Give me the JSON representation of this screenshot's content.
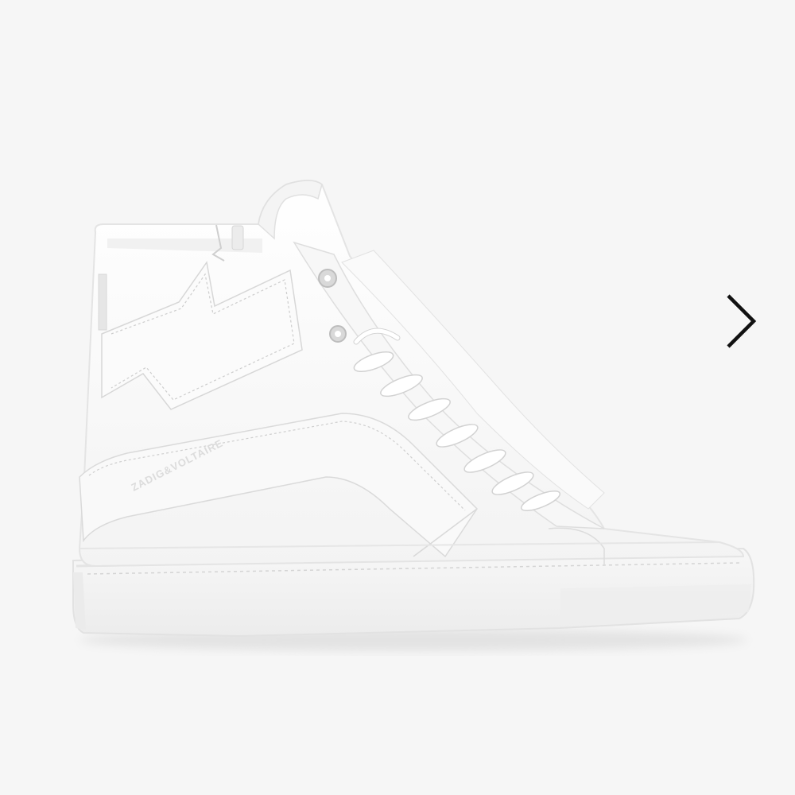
{
  "gallery": {
    "background": "#f6f6f6",
    "image": {
      "subject": "sneaker",
      "brand_emboss": "ZADIG&VOLTAIRE",
      "colors": {
        "leather": "#ffffff",
        "shade": "#e9e9e9",
        "stitch": "#c9c9c9",
        "sole": "#f0f0f0"
      }
    },
    "next_button": {
      "icon": "chevron-right-icon",
      "color": "#111111"
    }
  }
}
